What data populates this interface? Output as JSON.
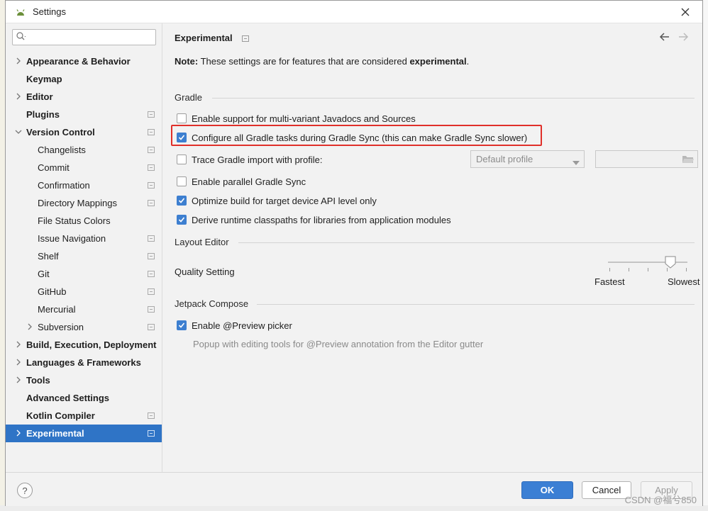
{
  "window": {
    "title": "Settings"
  },
  "search": {
    "placeholder": ""
  },
  "sidebar": {
    "items": [
      {
        "label": "Appearance & Behavior",
        "bold": true,
        "arrow": "right",
        "level": 0,
        "icon": false
      },
      {
        "label": "Keymap",
        "bold": true,
        "arrow": "",
        "level": 0,
        "icon": false
      },
      {
        "label": "Editor",
        "bold": true,
        "arrow": "right",
        "level": 0,
        "icon": false
      },
      {
        "label": "Plugins",
        "bold": true,
        "arrow": "",
        "level": 0,
        "icon": true
      },
      {
        "label": "Version Control",
        "bold": true,
        "arrow": "down",
        "level": 0,
        "icon": true
      },
      {
        "label": "Changelists",
        "bold": false,
        "arrow": "",
        "level": 1,
        "icon": true
      },
      {
        "label": "Commit",
        "bold": false,
        "arrow": "",
        "level": 1,
        "icon": true
      },
      {
        "label": "Confirmation",
        "bold": false,
        "arrow": "",
        "level": 1,
        "icon": true
      },
      {
        "label": "Directory Mappings",
        "bold": false,
        "arrow": "",
        "level": 1,
        "icon": true
      },
      {
        "label": "File Status Colors",
        "bold": false,
        "arrow": "",
        "level": 1,
        "icon": false
      },
      {
        "label": "Issue Navigation",
        "bold": false,
        "arrow": "",
        "level": 1,
        "icon": true
      },
      {
        "label": "Shelf",
        "bold": false,
        "arrow": "",
        "level": 1,
        "icon": true
      },
      {
        "label": "Git",
        "bold": false,
        "arrow": "",
        "level": 1,
        "icon": true
      },
      {
        "label": "GitHub",
        "bold": false,
        "arrow": "",
        "level": 1,
        "icon": true
      },
      {
        "label": "Mercurial",
        "bold": false,
        "arrow": "",
        "level": 1,
        "icon": true
      },
      {
        "label": "Subversion",
        "bold": false,
        "arrow": "right",
        "level": 1,
        "icon": true
      },
      {
        "label": "Build, Execution, Deployment",
        "bold": true,
        "arrow": "right",
        "level": 0,
        "icon": false
      },
      {
        "label": "Languages & Frameworks",
        "bold": true,
        "arrow": "right",
        "level": 0,
        "icon": false
      },
      {
        "label": "Tools",
        "bold": true,
        "arrow": "right",
        "level": 0,
        "icon": false
      },
      {
        "label": "Advanced Settings",
        "bold": true,
        "arrow": "",
        "level": 0,
        "icon": false
      },
      {
        "label": "Kotlin Compiler",
        "bold": true,
        "arrow": "",
        "level": 0,
        "icon": true
      },
      {
        "label": "Experimental",
        "bold": true,
        "arrow": "right",
        "level": 0,
        "icon": true,
        "selected": true
      }
    ]
  },
  "main": {
    "title": "Experimental",
    "note_prefix": "Note:",
    "note_text": " These settings are for features that are considered ",
    "note_emphasis": "experimental",
    "note_suffix": ".",
    "gradle": {
      "header": "Gradle",
      "opt_multivariant": {
        "label": "Enable support for multi-variant Javadocs and Sources",
        "checked": false
      },
      "opt_configure_all": {
        "label": "Configure all Gradle tasks during Gradle Sync (this can make Gradle Sync slower)",
        "checked": true
      },
      "opt_trace": {
        "label": "Trace Gradle import with profile:",
        "checked": false
      },
      "profile_combo": "Default profile",
      "opt_parallel": {
        "label": "Enable parallel Gradle Sync",
        "checked": false
      },
      "opt_optimize": {
        "label": "Optimize build for target device API level only",
        "checked": true
      },
      "opt_derive": {
        "label": "Derive runtime classpaths for libraries from application modules",
        "checked": true
      }
    },
    "layout_editor": {
      "header": "Layout Editor",
      "quality_label": "Quality Setting",
      "slider_min_label": "Fastest",
      "slider_max_label": "Slowest",
      "slider_value_fraction": 0.8
    },
    "compose": {
      "header": "Jetpack Compose",
      "opt_preview": {
        "label": "Enable @Preview picker",
        "checked": true
      },
      "preview_desc": "Popup with editing tools for @Preview annotation from the Editor gutter"
    }
  },
  "footer": {
    "help": "?",
    "ok": "OK",
    "cancel": "Cancel",
    "apply": "Apply"
  },
  "watermark": "CSDN @福兮850",
  "colors": {
    "accent": "#2f74c6",
    "highlight": "#e0302a"
  }
}
